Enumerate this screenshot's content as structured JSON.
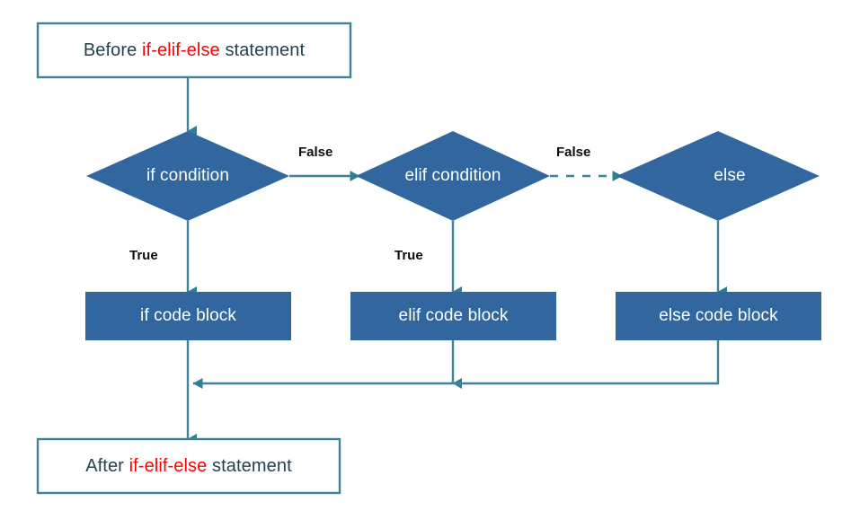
{
  "diagram": {
    "title": "if-elif-else statement flowchart",
    "colors": {
      "shape_fill": "#31679E",
      "box_border": "#3E8396",
      "box_fill": "#FFFFFF",
      "connector": "#3E8396",
      "arrow_fill": "#2E7F94",
      "text_dark": "#23424F",
      "text_light": "#FFFFFF",
      "keyword_red": "#FF0000",
      "label_text": "#0D0D0D"
    },
    "start_node": {
      "prefix": "Before ",
      "keyword": "if-elif-else",
      "suffix": " statement"
    },
    "end_node": {
      "prefix": "After ",
      "keyword": "if-elif-else",
      "suffix": " statement"
    },
    "decisions": [
      {
        "id": "if-condition",
        "label": "if condition"
      },
      {
        "id": "elif-condition",
        "label": "elif condition"
      },
      {
        "id": "else",
        "label": "else"
      }
    ],
    "processes": [
      {
        "id": "if-code-block",
        "label": "if code block"
      },
      {
        "id": "elif-code-block",
        "label": "elif code block"
      },
      {
        "id": "else-code-block",
        "label": "else code block"
      }
    ],
    "edge_labels": {
      "if_false": "False",
      "if_true": "True",
      "elif_false": "False",
      "elif_true": "True"
    }
  }
}
